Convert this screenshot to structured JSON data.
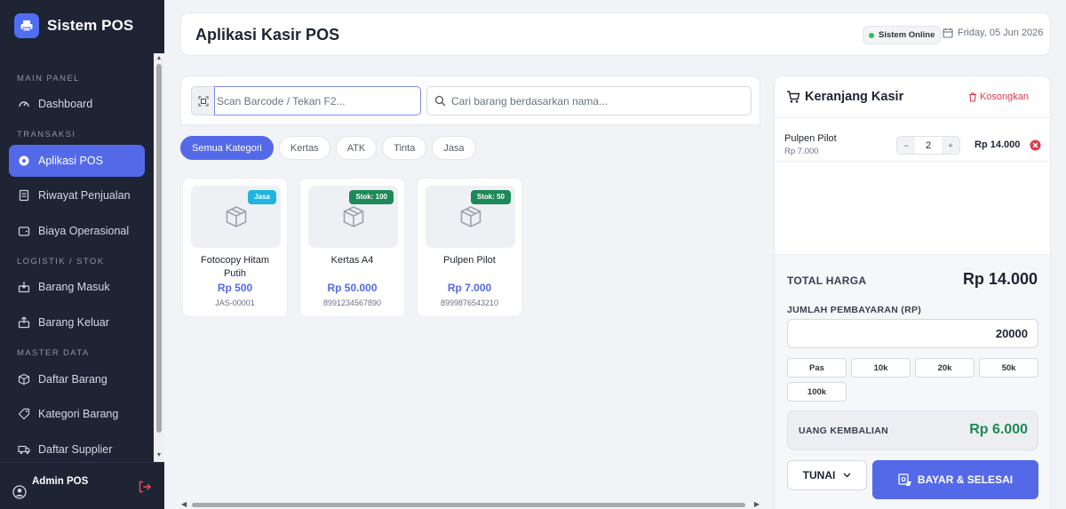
{
  "app": {
    "brand": "Sistem POS"
  },
  "sidebar": {
    "sections": [
      {
        "label": "MAIN PANEL"
      },
      {
        "label": "TRANSAKSI"
      },
      {
        "label": "LOGISTIK / STOK"
      },
      {
        "label": "MASTER DATA"
      }
    ],
    "items": [
      {
        "label": "Dashboard",
        "icon": "gauge-icon"
      },
      {
        "label": "Aplikasi POS",
        "icon": "settings-icon",
        "active": true
      },
      {
        "label": "Riwayat Penjualan",
        "icon": "receipt-icon"
      },
      {
        "label": "Biaya Operasional",
        "icon": "wallet-icon"
      },
      {
        "label": "Barang Masuk",
        "icon": "box-in-icon"
      },
      {
        "label": "Barang Keluar",
        "icon": "box-out-icon"
      },
      {
        "label": "Daftar Barang",
        "icon": "package-icon"
      },
      {
        "label": "Kategori Barang",
        "icon": "tag-icon"
      },
      {
        "label": "Daftar Supplier",
        "icon": "truck-icon"
      }
    ],
    "user": {
      "name": "Admin POS"
    }
  },
  "header": {
    "title": "Aplikasi Kasir POS",
    "status": "Sistem Online",
    "date": "Friday, 05 Jun 2026"
  },
  "search": {
    "barcode_placeholder": "Scan Barcode / Tekan F2...",
    "name_placeholder": "Cari barang berdasarkan nama..."
  },
  "categories": [
    "Semua Kategori",
    "Kertas",
    "ATK",
    "Tinta",
    "Jasa"
  ],
  "products": [
    {
      "badge": "Jasa",
      "name": "Fotocopy Hitam Putih",
      "price": "Rp 500",
      "code": "JAS-00001"
    },
    {
      "badge": "Stok: 100",
      "name": "Kertas A4",
      "price": "Rp 50.000",
      "code": "8991234567890"
    },
    {
      "badge": "Stok: 50",
      "name": "Pulpen Pilot",
      "price": "Rp 7.000",
      "code": "8999876543210"
    }
  ],
  "cart": {
    "title": "Keranjang Kasir",
    "clear_label": "Kosongkan",
    "items": [
      {
        "name": "Pulpen Pilot",
        "unit_price": "Rp 7.000",
        "qty": "2",
        "total": "Rp 14.000"
      }
    ],
    "total_label": "TOTAL HARGA",
    "total_value": "Rp 14.000",
    "payment_label": "JUMLAH PEMBAYARAN (RP)",
    "payment_value": "20000",
    "quick_amounts": [
      "Pas",
      "10k",
      "20k",
      "50k",
      "100k"
    ],
    "change_label": "UANG KEMBALIAN",
    "change_value": "Rp 6.000",
    "method": "TUNAI",
    "pay_button": "BAYAR & SELESAI"
  },
  "colors": {
    "accent": "#5469e8",
    "sidebar": "#1e2434",
    "success": "#1c8a56",
    "danger": "#e03a4a"
  }
}
